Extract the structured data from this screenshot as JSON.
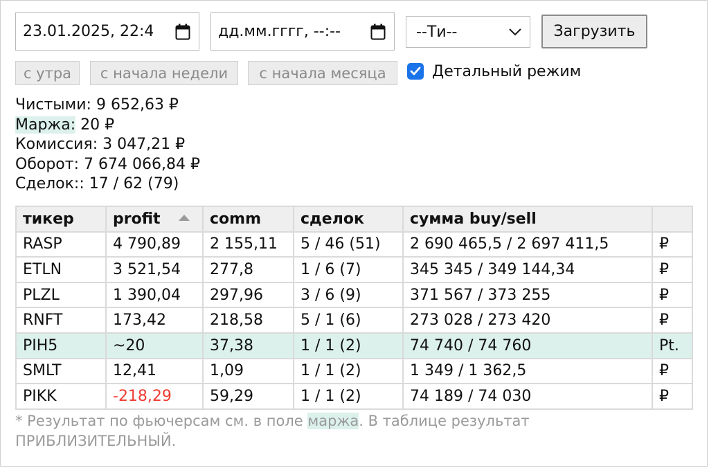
{
  "filters": {
    "date_from": "23.01.2025, 22:4",
    "date_to": "дд.мм.гггг, --:--",
    "type_select": "--Ти--",
    "load_button": "Загрузить"
  },
  "quick": {
    "morning": "с утра",
    "week": "с начала недели",
    "month": "с начала месяца",
    "detail_label": "Детальный режим",
    "detail_checked": true
  },
  "summary": {
    "net_label": "Чистыми:",
    "net_value": "9 652,63 ₽",
    "margin_label": "Маржа:",
    "margin_value": "20 ₽",
    "commission_label": "Комиссия:",
    "commission_value": "3 047,21 ₽",
    "turnover_label": "Оборот:",
    "turnover_value": "7 674 066,84 ₽",
    "deals_label": "Сделок::",
    "deals_value": "17 / 62 (79)"
  },
  "table": {
    "headers": {
      "ticker": "тикер",
      "profit": "profit",
      "comm": "comm",
      "deals": "сделок",
      "sum": "сумма buy/sell",
      "cur": ""
    },
    "rows": [
      {
        "ticker": "RASP",
        "profit": "4 790,89",
        "comm": "2 155,11",
        "deals": "5 / 46 (51)",
        "sum": "2 690 465,5 / 2 697 411,5",
        "cur": "₽"
      },
      {
        "ticker": "ETLN",
        "profit": "3 521,54",
        "comm": "277,8",
        "deals": "1 / 6 (7)",
        "sum": "345 345 / 349 144,34",
        "cur": "₽"
      },
      {
        "ticker": "PLZL",
        "profit": "1 390,04",
        "comm": "297,96",
        "deals": "3 / 6 (9)",
        "sum": "371 567 / 373 255",
        "cur": "₽"
      },
      {
        "ticker": "RNFT",
        "profit": "173,42",
        "comm": "218,58",
        "deals": "5 / 1 (6)",
        "sum": "273 028 / 273 420",
        "cur": "₽"
      },
      {
        "ticker": "PIH5",
        "profit": "~20",
        "comm": "37,38",
        "deals": "1 / 1 (2)",
        "sum": "74 740 / 74 760",
        "cur": "Pt."
      },
      {
        "ticker": "SMLT",
        "profit": "12,41",
        "comm": "1,09",
        "deals": "1 / 1 (2)",
        "sum": "1 349 / 1 362,5",
        "cur": "₽"
      },
      {
        "ticker": "PIKK",
        "profit": "-218,29",
        "comm": "59,29",
        "deals": "1 / 1 (2)",
        "sum": "74 189 / 74 030",
        "cur": "₽"
      }
    ]
  },
  "footnote": {
    "before": "* Результат по фьючерсам см. в поле ",
    "highlight": "маржа",
    "after": ". В таблице результат ПРИБЛИЗИТЕЛЬНЫЙ."
  },
  "colors": {
    "highlight": "#dcf1ec",
    "negative": "#ee3b33",
    "checkbox": "#1a73e8"
  }
}
